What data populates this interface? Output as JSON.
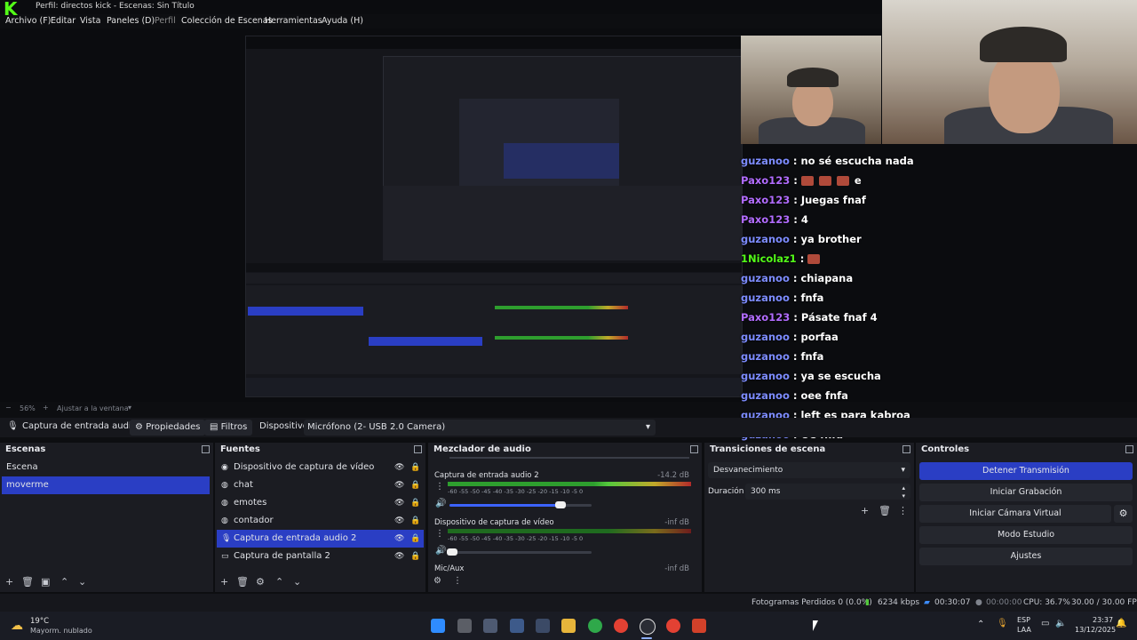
{
  "window": {
    "title": "Perfil: directos kick - Escenas: Sin Título"
  },
  "menu": [
    "Archivo (F)",
    "Editar",
    "Vista",
    "Paneles (D)",
    "Perfil",
    "Colección de Escenas",
    "Herramientas",
    "Ayuda (H)"
  ],
  "chat": [
    {
      "user": "guzanoo",
      "msg": "no sé escucha nada",
      "emotes": 0
    },
    {
      "user": "Paxo123",
      "msg": "e",
      "emotes": 3
    },
    {
      "user": "Paxo123",
      "msg": "Juegas fnaf",
      "emotes": 0
    },
    {
      "user": "Paxo123",
      "msg": "4",
      "emotes": 0
    },
    {
      "user": "guzanoo",
      "msg": "ya brother",
      "emotes": 0
    },
    {
      "user": "1Nicolaz1",
      "msg": "",
      "emotes": 1
    },
    {
      "user": "guzanoo",
      "msg": "chiapana",
      "emotes": 0
    },
    {
      "user": "guzanoo",
      "msg": "fnfa",
      "emotes": 0
    },
    {
      "user": "Paxo123",
      "msg": "Pásate fnaf 4",
      "emotes": 0
    },
    {
      "user": "guzanoo",
      "msg": "porfaa",
      "emotes": 0
    },
    {
      "user": "guzanoo",
      "msg": "fnfa",
      "emotes": 0
    },
    {
      "user": "guzanoo",
      "msg": "ya se escucha",
      "emotes": 0
    },
    {
      "user": "guzanoo",
      "msg": "oee fnfa",
      "emotes": 0
    },
    {
      "user": "guzanoo",
      "msg": "left es para kabroa",
      "emotes": 0
    },
    {
      "user": "guzanoo",
      "msg": "Oe fnfa",
      "emotes": 0
    }
  ],
  "preview": {
    "zoom": "56%",
    "fit": "Ajustar a la ventana"
  },
  "propbar": {
    "source": "Captura de entrada audio 2",
    "properties": "Propiedades",
    "filters": "Filtros",
    "device_label": "Dispositivo",
    "device_value": "Micrófono (2- USB 2.0 Camera)"
  },
  "scenes": {
    "title": "Escenas",
    "items": [
      "Escena",
      "moverme"
    ],
    "selected": 1
  },
  "sources": {
    "title": "Fuentes",
    "items": [
      "Dispositivo de captura de vídeo",
      "chat",
      "emotes",
      "contador",
      "Captura de entrada audio 2",
      "Captura de pantalla 2"
    ],
    "selected": 4
  },
  "mixer": {
    "title": "Mezclador de audio",
    "channels": [
      {
        "name": "Captura de entrada audio 2",
        "db": "-14.2 dB",
        "volume": 0.78
      },
      {
        "name": "Dispositivo de captura de vídeo",
        "db": "-inf dB",
        "volume": 0.02
      },
      {
        "name": "Mic/Aux",
        "db": "-inf dB"
      }
    ],
    "ticks": "-60 -55 -50 -45 -40 -35 -30 -25 -20 -15 -10 -5 0"
  },
  "transitions": {
    "title": "Transiciones de escena",
    "type": "Desvanecimiento",
    "duration_label": "Duración",
    "duration_value": "300 ms"
  },
  "controls": {
    "title": "Controles",
    "buttons": [
      "Detener Transmisión",
      "Iniciar Grabación",
      "Iniciar Cámara Virtual",
      "Modo Estudio",
      "Ajustes"
    ]
  },
  "status": {
    "dropped": "Fotogramas Perdidos 0 (0.0%)",
    "bitrate": "6234 kbps",
    "live_time": "00:30:07",
    "rec_time": "00:00:00",
    "cpu": "CPU: 36.7%",
    "fps": "30.00 / 30.00 FPS"
  },
  "taskbar": {
    "weather_temp": "19°C",
    "weather_desc": "Mayorm. nublado",
    "lang": "ESP",
    "lang2": "LAA",
    "time": "23:37",
    "date": "13/12/2025"
  },
  "colors": {
    "accent": "#2a3ec4",
    "kick_green": "#53fc18"
  }
}
